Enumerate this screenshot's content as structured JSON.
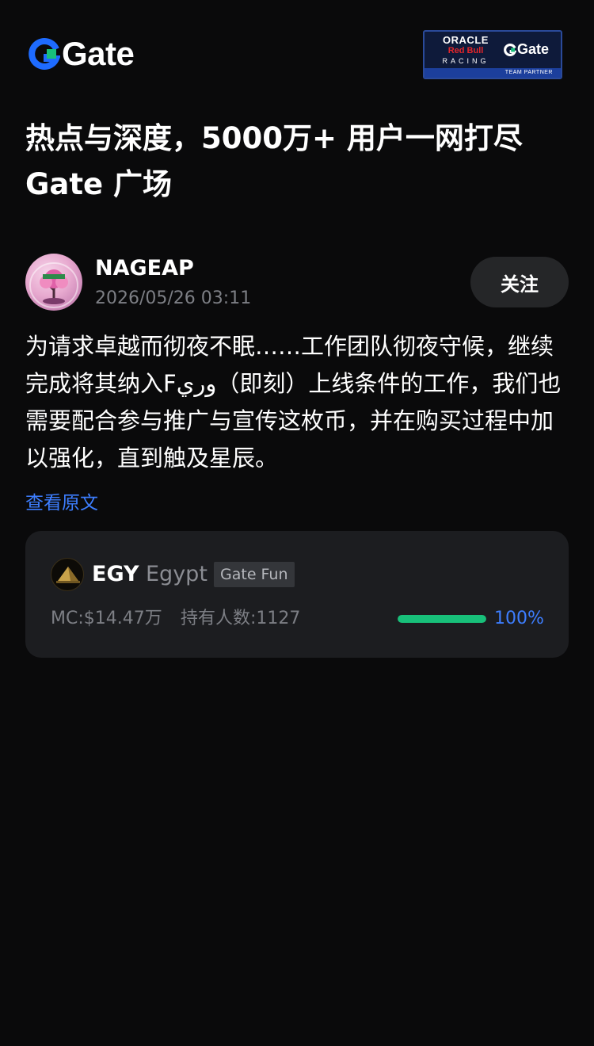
{
  "header": {
    "logo_text": "Gate",
    "partner_badge": {
      "line1": "ORACLE",
      "line2": "Red Bull",
      "line3": "RACING",
      "brand": "Gate",
      "strip": "TEAM PARTNER"
    },
    "colors": {
      "logo_blue": "#1e6bff",
      "logo_green": "#18c07a"
    }
  },
  "headline": "热点与深度，5000万+ 用户一网打尽 Gate 广场",
  "post": {
    "author_name": "NAGEAP",
    "timestamp": "2026/05/26 03:11",
    "follow_label": "关注",
    "body": "为请求卓越而彻夜不眠……工作团队彻夜守候，继续完成将其纳入Fوري（即刻）上线条件的工作，我们也需要配合参与推广与宣传这枚币，并在购买过程中加以强化，直到触及星辰。",
    "view_original_label": "查看原文"
  },
  "token_card": {
    "symbol": "EGY",
    "name": "Egypt",
    "tag": "Gate Fun",
    "market_cap": "MC:$14.47万",
    "holders": "持有人数:1127",
    "progress_fraction": 1.0,
    "progress_label": "100%",
    "colors": {
      "progress": "#18c07a",
      "percent": "#3d7eff"
    }
  }
}
